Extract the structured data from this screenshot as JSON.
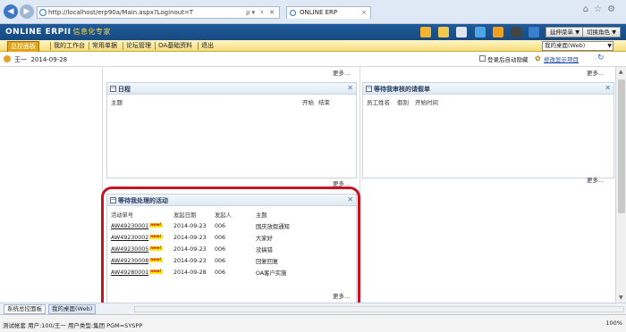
{
  "browser": {
    "url": "http://localhost/erp90a/Main.aspx?Loginout=T",
    "tab_title": "ONLINE ERP"
  },
  "app": {
    "brand": "ONLINE ERPII",
    "brand_sub": "信息化专家",
    "btn_shortcut": "延伸菜单 ▼",
    "btn_switch": "切换角色 ▼"
  },
  "menu": {
    "items": [
      "总控面板",
      "我的工作台",
      "常用单据",
      "论坛管理",
      "OA基础资料",
      "退出"
    ],
    "desk_select": "我的桌面(Web)"
  },
  "user": {
    "name": "王一",
    "date": "2014-09-28",
    "auto_hide_label": "登录后自动隐藏",
    "show_items_link": "修改显示项目"
  },
  "widgets": {
    "more": "更多...",
    "schedule": {
      "title": "日程",
      "cols": [
        "主题",
        "开始",
        "结束"
      ]
    },
    "approval": {
      "title": "等待我审核的请假单",
      "cols": [
        "员工姓名",
        "假别",
        "开始时间"
      ]
    },
    "pending": {
      "title": "等待我处理的活动",
      "cols": [
        "活动单号",
        "发起日期",
        "发起人",
        "主题"
      ],
      "rows": [
        {
          "id": "AW49230001",
          "badge": "new!",
          "date": "2014-09-23",
          "by": "006",
          "topic": "国庆放假通知"
        },
        {
          "id": "AW49230002",
          "badge": "new!",
          "date": "2014-09-23",
          "by": "006",
          "topic": "大家好"
        },
        {
          "id": "AW49230005",
          "badge": "new!",
          "date": "2014-09-23",
          "by": "006",
          "topic": "没搞错"
        },
        {
          "id": "AW49230008",
          "badge": "new!",
          "date": "2014-09-23",
          "by": "006",
          "topic": "回复回复"
        },
        {
          "id": "AW49280001",
          "badge": "new!",
          "date": "2014-09-28",
          "by": "006",
          "topic": "OA客户实施"
        }
      ]
    }
  },
  "bottom_tabs": [
    "系统总控面板",
    "我的桌面(Web)"
  ],
  "status": {
    "text": "测试帐套    用户:100/王一    用户类型:集团    PGM=SYSPP",
    "zoom": "100%"
  }
}
